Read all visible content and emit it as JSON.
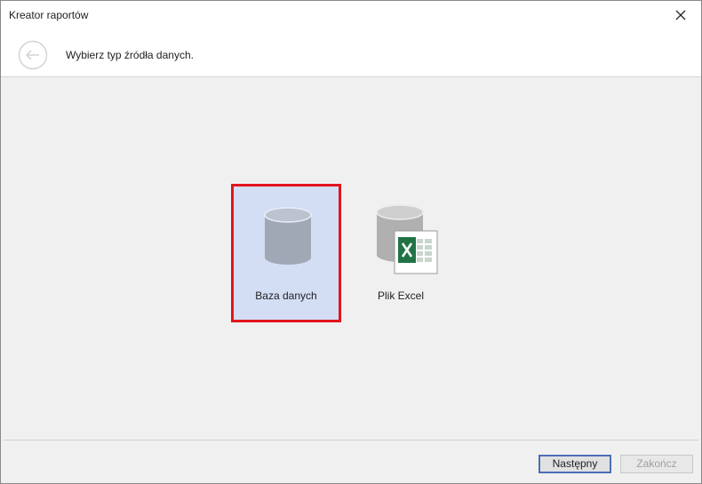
{
  "window": {
    "title": "Kreator raportów"
  },
  "header": {
    "instruction": "Wybierz typ źródła danych."
  },
  "options": [
    {
      "label": "Baza danych",
      "icon": "database-icon",
      "selected": true
    },
    {
      "label": "Plik Excel",
      "icon": "excel-file-icon",
      "selected": false
    }
  ],
  "footer": {
    "next_label": "Następny",
    "finish_label": "Zakończ",
    "finish_enabled": false
  },
  "colors": {
    "selection_fill": "#d3def5",
    "selection_border": "#e3141c",
    "excel_green": "#217346",
    "default_button_border": "#4a6fb5"
  }
}
